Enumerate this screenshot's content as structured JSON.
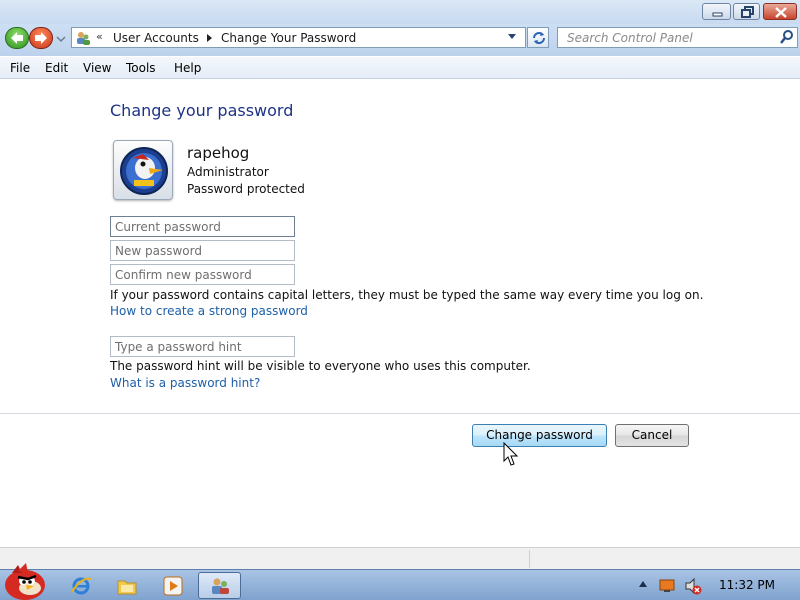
{
  "window": {
    "minimize_label": "",
    "maximize_label": "",
    "close_label": ""
  },
  "address": {
    "overflow": "«",
    "crumbs": [
      "User Accounts",
      "Change Your Password"
    ]
  },
  "search": {
    "placeholder": "Search Control Panel"
  },
  "menu": {
    "items": [
      "File",
      "Edit",
      "View",
      "Tools",
      "Help"
    ]
  },
  "main": {
    "title": "Change your password",
    "user": {
      "name": "rapehog",
      "role": "Administrator",
      "status": "Password protected"
    },
    "fields": {
      "current_placeholder": "Current password",
      "new_placeholder": "New password",
      "confirm_placeholder": "Confirm new password",
      "hint_placeholder": "Type a password hint"
    },
    "capital_note": "If your password contains capital letters, they must be typed the same way every time you log on.",
    "strong_link": "How to create a strong password",
    "hint_note": "The password hint will be visible to everyone who uses this computer.",
    "hint_link": "What is a password hint?",
    "buttons": {
      "change": "Change password",
      "cancel": "Cancel"
    }
  },
  "taskbar": {
    "clock": "11:32 PM",
    "icons": [
      "start-orb-icon",
      "internet-explorer-icon",
      "folder-icon",
      "media-player-icon",
      "user-accounts-icon",
      "show-hidden-icons-icon",
      "network-icon",
      "volume-muted-icon"
    ]
  },
  "colors": {
    "title_blue": "#1e3287",
    "link_blue": "#1d5fa8",
    "primary_button": "#bee6fd"
  }
}
